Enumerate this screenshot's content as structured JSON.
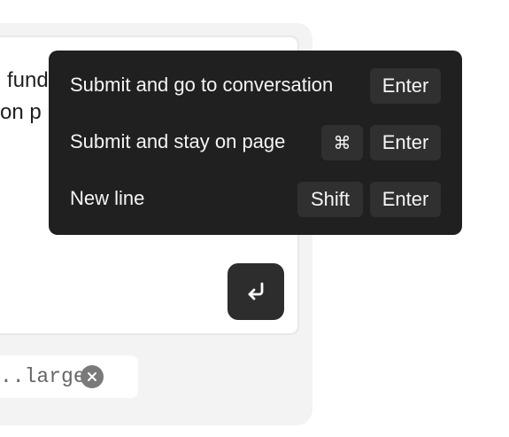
{
  "composer": {
    "text_line_1": "fund",
    "text_line_2": "on p"
  },
  "attachment_chip": {
    "label": "..large"
  },
  "tooltip": {
    "rows": [
      {
        "label": "Submit and go to conversation",
        "keys": [
          "Enter"
        ]
      },
      {
        "label": "Submit and stay on page",
        "keys": [
          "⌘",
          "Enter"
        ]
      },
      {
        "label": "New line",
        "keys": [
          "Shift",
          "Enter"
        ]
      }
    ]
  },
  "icons": {
    "send": "enter-arrow-icon",
    "chip_remove": "close-icon"
  },
  "colors": {
    "tooltip_bg": "#202020",
    "button_bg": "#2d2d2d",
    "panel_bg": "#f3f3f3"
  }
}
